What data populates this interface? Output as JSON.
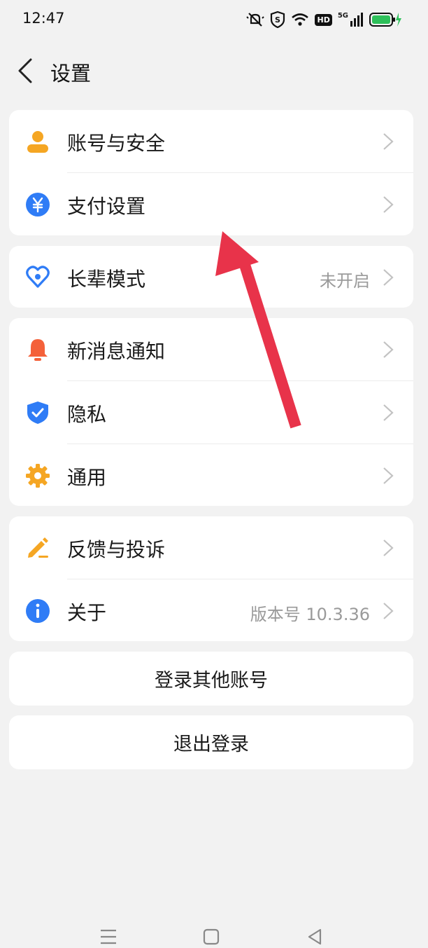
{
  "status_bar": {
    "time": "12:47",
    "network": "5G",
    "hd_badge": "HD"
  },
  "header": {
    "title": "设置"
  },
  "groups": [
    [
      {
        "label": "账号与安全",
        "value": "",
        "icon": "user-icon"
      },
      {
        "label": "支付设置",
        "value": "",
        "icon": "yuan-icon"
      }
    ],
    [
      {
        "label": "长辈模式",
        "value": "未开启",
        "icon": "heart-icon"
      }
    ],
    [
      {
        "label": "新消息通知",
        "value": "",
        "icon": "bell-icon"
      },
      {
        "label": "隐私",
        "value": "",
        "icon": "shield-icon"
      },
      {
        "label": "通用",
        "value": "",
        "icon": "gear-icon"
      }
    ],
    [
      {
        "label": "反馈与投诉",
        "value": "",
        "icon": "pencil-icon"
      },
      {
        "label": "关于",
        "value": "版本号 10.3.36",
        "icon": "info-icon"
      }
    ]
  ],
  "buttons": {
    "login_other": "登录其他账号",
    "logout": "退出登录"
  },
  "colors": {
    "orange": "#f5a623",
    "blue": "#2f7cf6",
    "red": "#f4613a",
    "annotation_arrow": "#e8334a"
  }
}
